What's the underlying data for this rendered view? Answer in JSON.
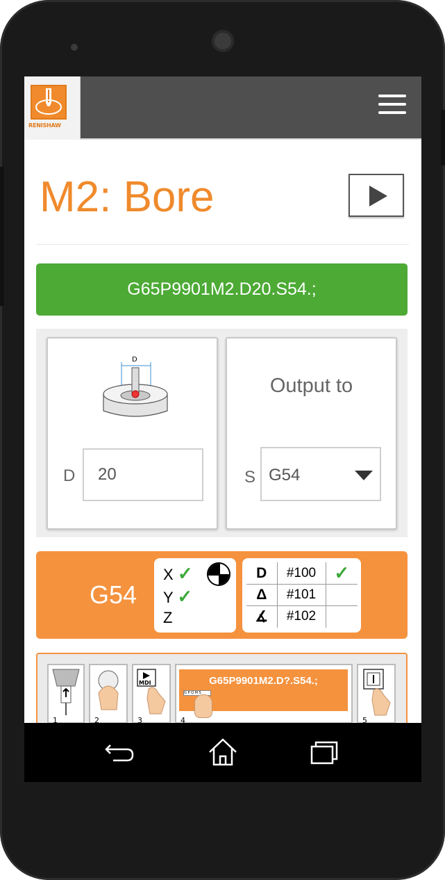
{
  "app": {
    "logo_text": "RENISHAW",
    "colors": {
      "brand_orange": "#f08a2c",
      "success_green": "#4caa35",
      "appbar": "#4f4f4f",
      "panel_orange": "#f5923e"
    }
  },
  "header": {
    "title": "M2: Bore",
    "play_icon": "play-icon",
    "menu_icon": "hamburger-menu-icon"
  },
  "gcode": {
    "command": "G65P9901M2.D20.S54.;"
  },
  "inputs": {
    "diameter": {
      "diagram_label": "D",
      "label": "D",
      "value": "20"
    },
    "output": {
      "title": "Output to",
      "label": "S",
      "selected": "G54"
    }
  },
  "summary": {
    "work_offset": "G54",
    "axes": [
      {
        "name": "X",
        "checked": true
      },
      {
        "name": "Y",
        "checked": true
      },
      {
        "name": "Z",
        "checked": false
      }
    ],
    "variables": [
      {
        "symbol": "D",
        "var": "#100",
        "checked": true
      },
      {
        "symbol": "Δ",
        "var": "#101",
        "checked": false
      },
      {
        "symbol": "∡",
        "var": "#102",
        "checked": false
      }
    ]
  },
  "steps": {
    "items": [
      "1",
      "2",
      "3",
      "4",
      "5"
    ],
    "mdi_label": "MDI",
    "code_label": "G65P9901M2.D?.S54.;",
    "key_label": "G P Q M S"
  },
  "nav": {
    "back_icon": "back-icon",
    "home_icon": "home-icon",
    "recents_icon": "recents-icon"
  }
}
